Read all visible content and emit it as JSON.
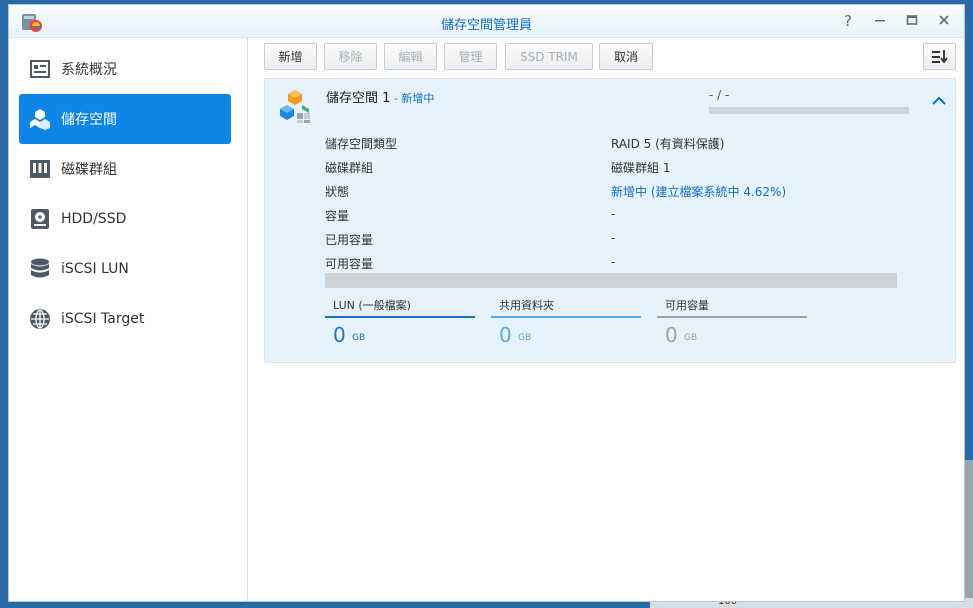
{
  "window": {
    "title": "儲存空間管理員"
  },
  "sidebar": {
    "items": [
      {
        "label": "系統概況",
        "icon": "overview-icon"
      },
      {
        "label": "儲存空間",
        "icon": "storage-cubes-icon",
        "active": true
      },
      {
        "label": "磁碟群組",
        "icon": "disk-group-icon"
      },
      {
        "label": "HDD/SSD",
        "icon": "hdd-icon"
      },
      {
        "label": "iSCSI LUN",
        "icon": "database-icon"
      },
      {
        "label": "iSCSI Target",
        "icon": "globe-icon"
      }
    ]
  },
  "toolbar": {
    "create": "新增",
    "remove": "移除",
    "edit": "編輯",
    "manage": "管理",
    "ssd_trim": "SSD TRIM",
    "cancel": "取消"
  },
  "pool": {
    "name": "儲存空間 1",
    "separator": " - ",
    "state": "新增中",
    "usage_text": "- / -",
    "details": {
      "type_label": "儲存空間類型",
      "type_value": "RAID 5 (有資料保護)",
      "group_label": "磁碟群組",
      "group_value": "磁碟群組 1",
      "status_label": "狀態",
      "status_state": "新增中",
      "status_open": " (",
      "status_progress": "建立檔案系統中 4.62%",
      "status_close": ")",
      "capacity_label": "容量",
      "capacity_value": "-",
      "used_label": "已用容量",
      "used_value": "-",
      "available_label": "可用容量",
      "available_value": "-"
    },
    "stats": [
      {
        "label": "LUN (一般檔案)",
        "value": "0",
        "unit": "GB",
        "color": "#1f73c4"
      },
      {
        "label": "共用資料夾",
        "value": "0",
        "unit": "GB",
        "color": "#59a9e6"
      },
      {
        "label": "可用容量",
        "value": "0",
        "unit": "GB",
        "color": "#9aa3aa"
      }
    ]
  },
  "desktop": {
    "background_number": "100"
  },
  "colors": {
    "accent": "#0e86e8",
    "link": "#0f6fc6"
  }
}
